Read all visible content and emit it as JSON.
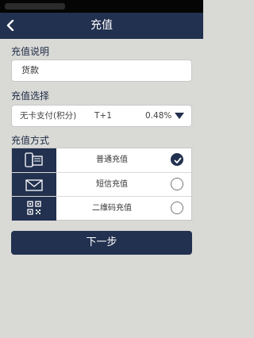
{
  "nav": {
    "title": "充值"
  },
  "description": {
    "label": "充值说明",
    "value": "货款"
  },
  "option": {
    "label": "充值选择",
    "payment_type": "无卡支付(积分)",
    "settlement": "T+1",
    "rate": "0.48%"
  },
  "methods": {
    "label": "充值方式",
    "items": [
      {
        "label": "普通充值",
        "icon": "card-reader-icon",
        "selected": true
      },
      {
        "label": "短信充值",
        "icon": "envelope-icon",
        "selected": false
      },
      {
        "label": "二维码充值",
        "icon": "qr-code-icon",
        "selected": false
      }
    ]
  },
  "next_button": {
    "label": "下一步"
  },
  "colors": {
    "primary": "#22314f",
    "background": "#d9d9d6"
  }
}
